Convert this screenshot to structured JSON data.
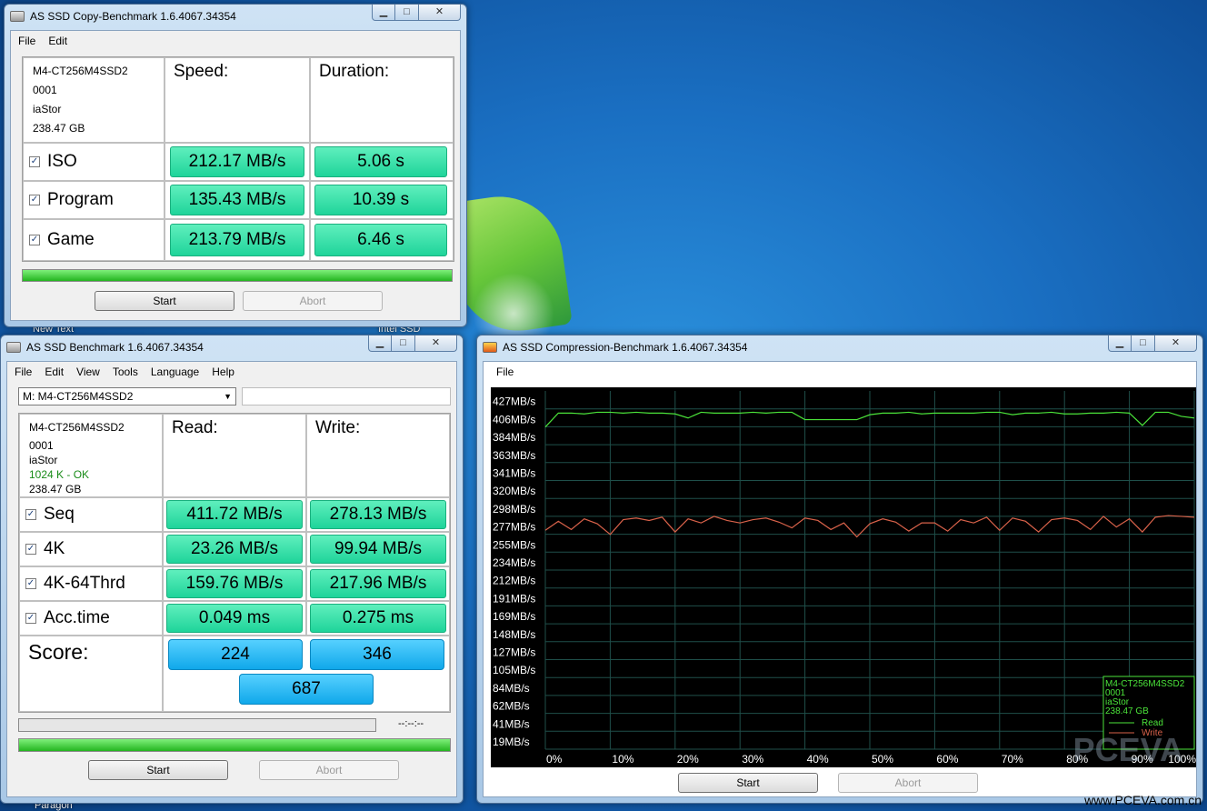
{
  "desktop": {
    "labels": [
      "New Text",
      "Intel SSD",
      "Paragon"
    ],
    "watermark": "PCEVA",
    "site": "www.PCEVA.com.cn"
  },
  "copy_window": {
    "title": "AS SSD Copy-Benchmark 1.6.4067.34354",
    "menu": [
      "File",
      "Edit"
    ],
    "drive": {
      "model": "M4-CT256M4SSD2",
      "fw": "0001",
      "driver": "iaStor",
      "size": "238.47 GB"
    },
    "headers": {
      "speed": "Speed:",
      "duration": "Duration:"
    },
    "rows": [
      {
        "label": "ISO",
        "checked": true,
        "speed": "212.17 MB/s",
        "duration": "5.06 s"
      },
      {
        "label": "Program",
        "checked": true,
        "speed": "135.43 MB/s",
        "duration": "10.39 s"
      },
      {
        "label": "Game",
        "checked": true,
        "speed": "213.79 MB/s",
        "duration": "6.46 s"
      }
    ],
    "progress": 1.0,
    "start_label": "Start",
    "abort_label": "Abort"
  },
  "bench_window": {
    "title": "AS SSD Benchmark 1.6.4067.34354",
    "menu": [
      "File",
      "Edit",
      "View",
      "Tools",
      "Language",
      "Help"
    ],
    "drive_select": "M: M4-CT256M4SSD2",
    "drive": {
      "model": "M4-CT256M4SSD2",
      "fw": "0001",
      "driver": "iaStor",
      "align": "1024 K - OK",
      "size": "238.47 GB"
    },
    "headers": {
      "read": "Read:",
      "write": "Write:"
    },
    "rows": [
      {
        "label": "Seq",
        "checked": true,
        "read": "411.72 MB/s",
        "write": "278.13 MB/s"
      },
      {
        "label": "4K",
        "checked": true,
        "read": "23.26 MB/s",
        "write": "99.94 MB/s"
      },
      {
        "label": "4K-64Thrd",
        "checked": true,
        "read": "159.76 MB/s",
        "write": "217.96 MB/s"
      },
      {
        "label": "Acc.time",
        "checked": true,
        "read": "0.049 ms",
        "write": "0.275 ms"
      }
    ],
    "score_label": "Score:",
    "score_read": "224",
    "score_write": "346",
    "score_total": "687",
    "time_readout": "--:--:--",
    "progress_top": 0.0,
    "progress_bottom": 1.0,
    "start_label": "Start",
    "abort_label": "Abort"
  },
  "compression_window": {
    "title": "AS SSD Compression-Benchmark 1.6.4067.34354",
    "menu": [
      "File"
    ],
    "start_label": "Start",
    "abort_label": "Abort",
    "legend": {
      "model": "M4-CT256M4SSD2",
      "fw": "0001",
      "driver": "iaStor",
      "size": "238.47 GB",
      "read": "Read",
      "write": "Write"
    }
  },
  "chart_data": {
    "type": "line",
    "title": "",
    "xlabel": "",
    "ylabel": "",
    "y_tick_labels": [
      "427MB/s",
      "406MB/s",
      "384MB/s",
      "363MB/s",
      "341MB/s",
      "320MB/s",
      "298MB/s",
      "277MB/s",
      "255MB/s",
      "234MB/s",
      "212MB/s",
      "191MB/s",
      "169MB/s",
      "148MB/s",
      "127MB/s",
      "105MB/s",
      "84MB/s",
      "62MB/s",
      "41MB/s",
      "19MB/s"
    ],
    "x_tick_labels": [
      "0%",
      "10%",
      "20%",
      "30%",
      "40%",
      "50%",
      "60%",
      "70%",
      "80%",
      "90%",
      "100%"
    ],
    "ylim": [
      0,
      437
    ],
    "xlim": [
      0,
      100
    ],
    "grid": true,
    "legend_position": "bottom-right",
    "colors": {
      "read": "#4be33a",
      "write": "#d9624a",
      "grid": "#1f4f4a",
      "text": "#ffffff"
    },
    "x": [
      0,
      2,
      4,
      6,
      8,
      10,
      12,
      14,
      16,
      18,
      20,
      22,
      24,
      26,
      28,
      30,
      32,
      34,
      36,
      38,
      40,
      42,
      44,
      46,
      48,
      50,
      52,
      54,
      56,
      58,
      60,
      62,
      64,
      66,
      68,
      70,
      72,
      74,
      76,
      78,
      80,
      82,
      84,
      86,
      88,
      90,
      92,
      94,
      96,
      98,
      100
    ],
    "series": [
      {
        "name": "Read",
        "values": [
          393,
          410,
          410,
          409,
          411,
          411,
          410,
          411,
          410,
          410,
          409,
          404,
          411,
          410,
          410,
          410,
          411,
          410,
          411,
          411,
          402,
          402,
          402,
          402,
          402,
          408,
          410,
          410,
          411,
          409,
          410,
          410,
          410,
          410,
          411,
          411,
          408,
          410,
          410,
          411,
          409,
          409,
          410,
          410,
          411,
          410,
          395,
          411,
          411,
          406,
          404
        ]
      },
      {
        "name": "Write",
        "values": [
          267,
          278,
          268,
          281,
          275,
          262,
          280,
          282,
          279,
          283,
          265,
          281,
          276,
          284,
          279,
          276,
          280,
          282,
          277,
          270,
          282,
          279,
          268,
          276,
          259,
          275,
          281,
          277,
          266,
          276,
          276,
          266,
          280,
          276,
          283,
          267,
          282,
          278,
          265,
          280,
          282,
          279,
          268,
          284,
          271,
          281,
          265,
          283,
          285,
          284,
          283
        ]
      }
    ]
  }
}
